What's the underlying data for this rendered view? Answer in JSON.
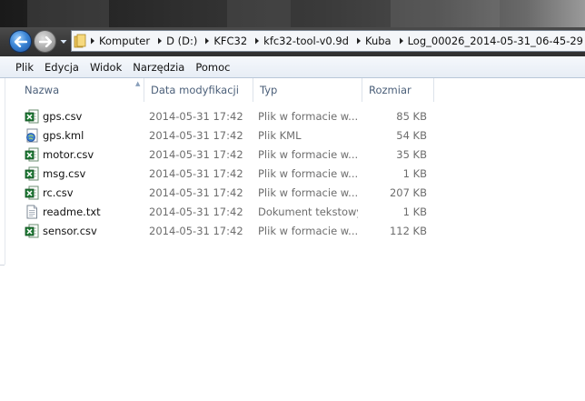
{
  "window": {
    "address": [
      "Komputer",
      "D (D:)",
      "KFC32",
      "kfc32-tool-v0.9d",
      "Kuba",
      "Log_00026_2014-05-31_06-45-29"
    ]
  },
  "menu": [
    "Plik",
    "Edycja",
    "Widok",
    "Narzędzia",
    "Pomoc"
  ],
  "columns": {
    "name": "Nazwa",
    "date": "Data modyfikacji",
    "type": "Typ",
    "size": "Rozmiar"
  },
  "files": [
    {
      "name": "gps.csv",
      "date": "2014-05-31 17:42",
      "type": "Plik w formacie w...",
      "size": "85 KB",
      "icon": "excel-icon"
    },
    {
      "name": "gps.kml",
      "date": "2014-05-31 17:42",
      "type": "Plik KML",
      "size": "54 KB",
      "icon": "kml-icon"
    },
    {
      "name": "motor.csv",
      "date": "2014-05-31 17:42",
      "type": "Plik w formacie w...",
      "size": "35 KB",
      "icon": "excel-icon"
    },
    {
      "name": "msg.csv",
      "date": "2014-05-31 17:42",
      "type": "Plik w formacie w...",
      "size": "1 KB",
      "icon": "excel-icon"
    },
    {
      "name": "rc.csv",
      "date": "2014-05-31 17:42",
      "type": "Plik w formacie w...",
      "size": "207 KB",
      "icon": "excel-icon"
    },
    {
      "name": "readme.txt",
      "date": "2014-05-31 17:42",
      "type": "Dokument tekstowy",
      "size": "1 KB",
      "icon": "text-file-icon"
    },
    {
      "name": "sensor.csv",
      "date": "2014-05-31 17:42",
      "type": "Plik w formacie w...",
      "size": "112 KB",
      "icon": "excel-icon"
    }
  ],
  "colors": {
    "header_text": "#4c607a",
    "excel_green": "#1f7a35",
    "nav_blue": "#3c86d6"
  }
}
